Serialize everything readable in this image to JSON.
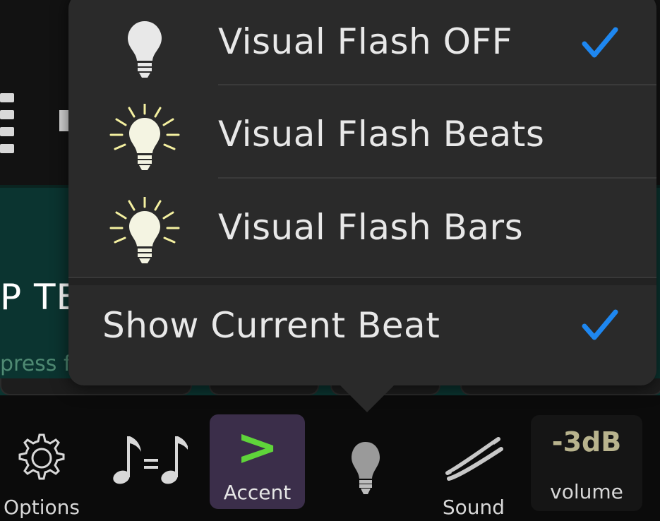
{
  "background": {
    "title_fragment": "P TE",
    "subtitle_fragment": "press f"
  },
  "menu": {
    "items": [
      {
        "label": "Visual Flash OFF",
        "icon": "lightbulb-off-icon",
        "checked": true
      },
      {
        "label": "Visual Flash Beats",
        "icon": "lightbulb-glow-icon",
        "checked": false
      },
      {
        "label": "Visual Flash Bars",
        "icon": "lightbulb-glow-icon",
        "checked": false
      }
    ],
    "show_current_beat": {
      "label": "Show Current Beat",
      "checked": true
    },
    "check_color": "#1e87f0"
  },
  "toolbar": {
    "options_label": "Options",
    "accent_symbol": ">",
    "accent_label": "Accent",
    "sound_label": "Sound",
    "volume_value": "-3dB",
    "volume_label": "volume",
    "accent_color": "#5fd43a",
    "accent_bg": "#3b2e4a"
  }
}
